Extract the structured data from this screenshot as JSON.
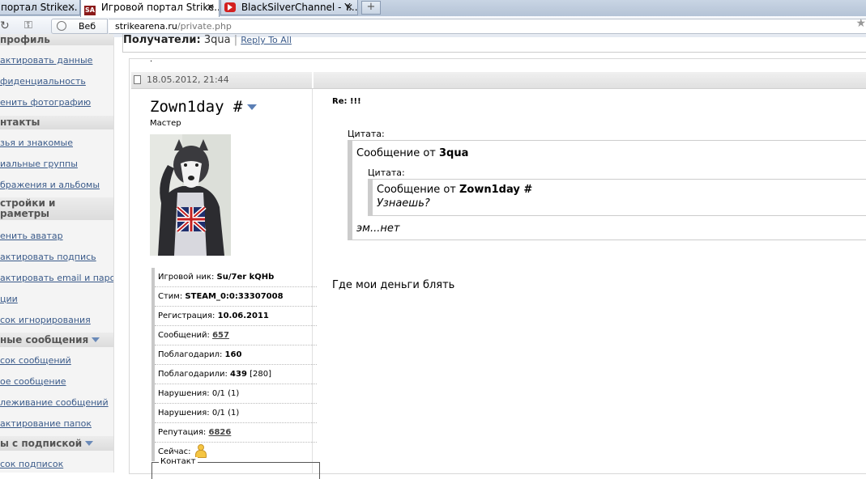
{
  "browser": {
    "tabs": [
      {
        "label": "портал Strike...",
        "active": false
      },
      {
        "label": "Игровой портал Strike...",
        "active": true
      },
      {
        "label": "BlackSilverChannel - Y...",
        "active": false
      }
    ],
    "web_label": "Веб",
    "url_host": "strikearena.ru",
    "url_path": "/private.php"
  },
  "sidebar": {
    "sections": [
      {
        "title": "профиль",
        "items": [
          "актировать данные",
          "фиденциальность",
          "енить фотографию"
        ]
      },
      {
        "title": "нтакты",
        "items": [
          "зья и знакомые",
          "иальные группы",
          "бражения и альбомы"
        ]
      },
      {
        "title_line1": "стройки и",
        "title_line2": "раметры",
        "items": [
          "енить аватар",
          "актировать подпись",
          "актировать email и пароль",
          "ции",
          "сок игнорирования"
        ]
      },
      {
        "title": "ные сообщения",
        "items": [
          "сок сообщений",
          "ое сообщение",
          "леживание сообщений",
          "актирование папок"
        ]
      },
      {
        "title": "ы с подпиской",
        "items": [
          "сок подписок"
        ]
      }
    ]
  },
  "recipients": {
    "label": "Получатели:",
    "name": "3qua",
    "separator": "|",
    "reply_all": "Reply To All"
  },
  "post": {
    "dot": "·",
    "date": "18.05.2012, 21:44",
    "username": "Zown1day #",
    "usertitle": "Мастер",
    "stats": {
      "nick_label": "Игровой ник:",
      "nick_value": "Su/7er kQHb",
      "steam_label": "Стим:",
      "steam_value": "STEAM_0:0:33307008",
      "reg_label": "Регистрация:",
      "reg_value": "10.06.2011",
      "posts_label": "Сообщений:",
      "posts_value": "657",
      "thanked_label": "Поблагодарил:",
      "thanked_value": "160",
      "thanks_label": "Поблагодарили:",
      "thanks_value": "439",
      "thanks_extra": "[280]",
      "warn1_label": "Нарушения:",
      "warn1_value": "0/1 (1)",
      "warn2_label": "Нарушения:",
      "warn2_value": "0/1 (1)",
      "rep_label": "Репутация:",
      "rep_value": "6826",
      "now_label": "Сейчас:"
    },
    "contact_label": "Контакт",
    "message": {
      "title": "Re: !!!",
      "quote_label": "Цитата:",
      "quote_from_prefix": "Сообщение от",
      "quote_from_name": "3qua",
      "inner_quote_label": "Цитата:",
      "inner_from_prefix": "Сообщение от",
      "inner_from_name": "Zown1day #",
      "inner_text": "Узнаешь?",
      "quote_text": "эм...нет",
      "body": "Где мои деньги блять"
    }
  }
}
